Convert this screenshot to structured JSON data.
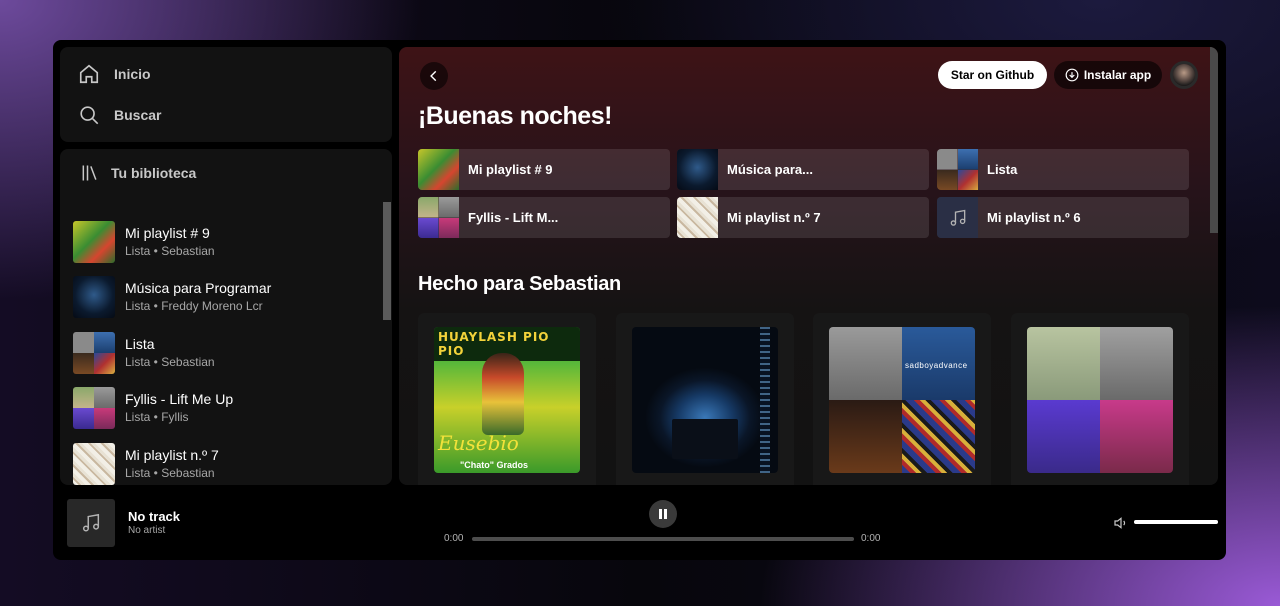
{
  "nav": {
    "home_label": "Inicio",
    "search_label": "Buscar"
  },
  "library": {
    "title": "Tu biblioteca",
    "items": [
      {
        "name": "Mi playlist # 9",
        "meta": "Lista • Sebastian"
      },
      {
        "name": "Música para Programar",
        "meta": "Lista • Freddy Moreno Lcr"
      },
      {
        "name": "Lista",
        "meta": "Lista • Sebastian"
      },
      {
        "name": "Fyllis - Lift Me Up",
        "meta": "Lista • Fyllis"
      },
      {
        "name": "Mi playlist n.º 7",
        "meta": "Lista • Sebastian"
      }
    ]
  },
  "header": {
    "star_label": "Star on Github",
    "install_label": "Instalar app"
  },
  "main": {
    "greeting": "¡Buenas noches!",
    "quick": [
      {
        "label": "Mi playlist # 9"
      },
      {
        "label": "Música para..."
      },
      {
        "label": "Lista"
      },
      {
        "label": "Fyllis - Lift M..."
      },
      {
        "label": "Mi playlist n.º 7"
      },
      {
        "label": "Mi playlist n.º 6"
      }
    ],
    "section_title": "Hecho para Sebastian",
    "cards": [
      {
        "art": "Huaylash album cover",
        "art_title": "HUAYLASH PIO PIO",
        "art_sub": "Eusebio",
        "art_sub2": "\"Chato\" Grados"
      },
      {
        "art": "coding in dark photo"
      },
      {
        "art": "sadboyadvance collage",
        "art_text": "sadboyadvance"
      },
      {
        "art": "portrait collage"
      }
    ]
  },
  "player": {
    "track": "No track",
    "artist": "No artist",
    "time_current": "0:00",
    "time_total": "0:00",
    "progress": 0,
    "volume": 1.0
  },
  "colors": {
    "accent_bg": "#3e1316",
    "panel": "#121212",
    "text_dim": "#a7a7a7"
  }
}
